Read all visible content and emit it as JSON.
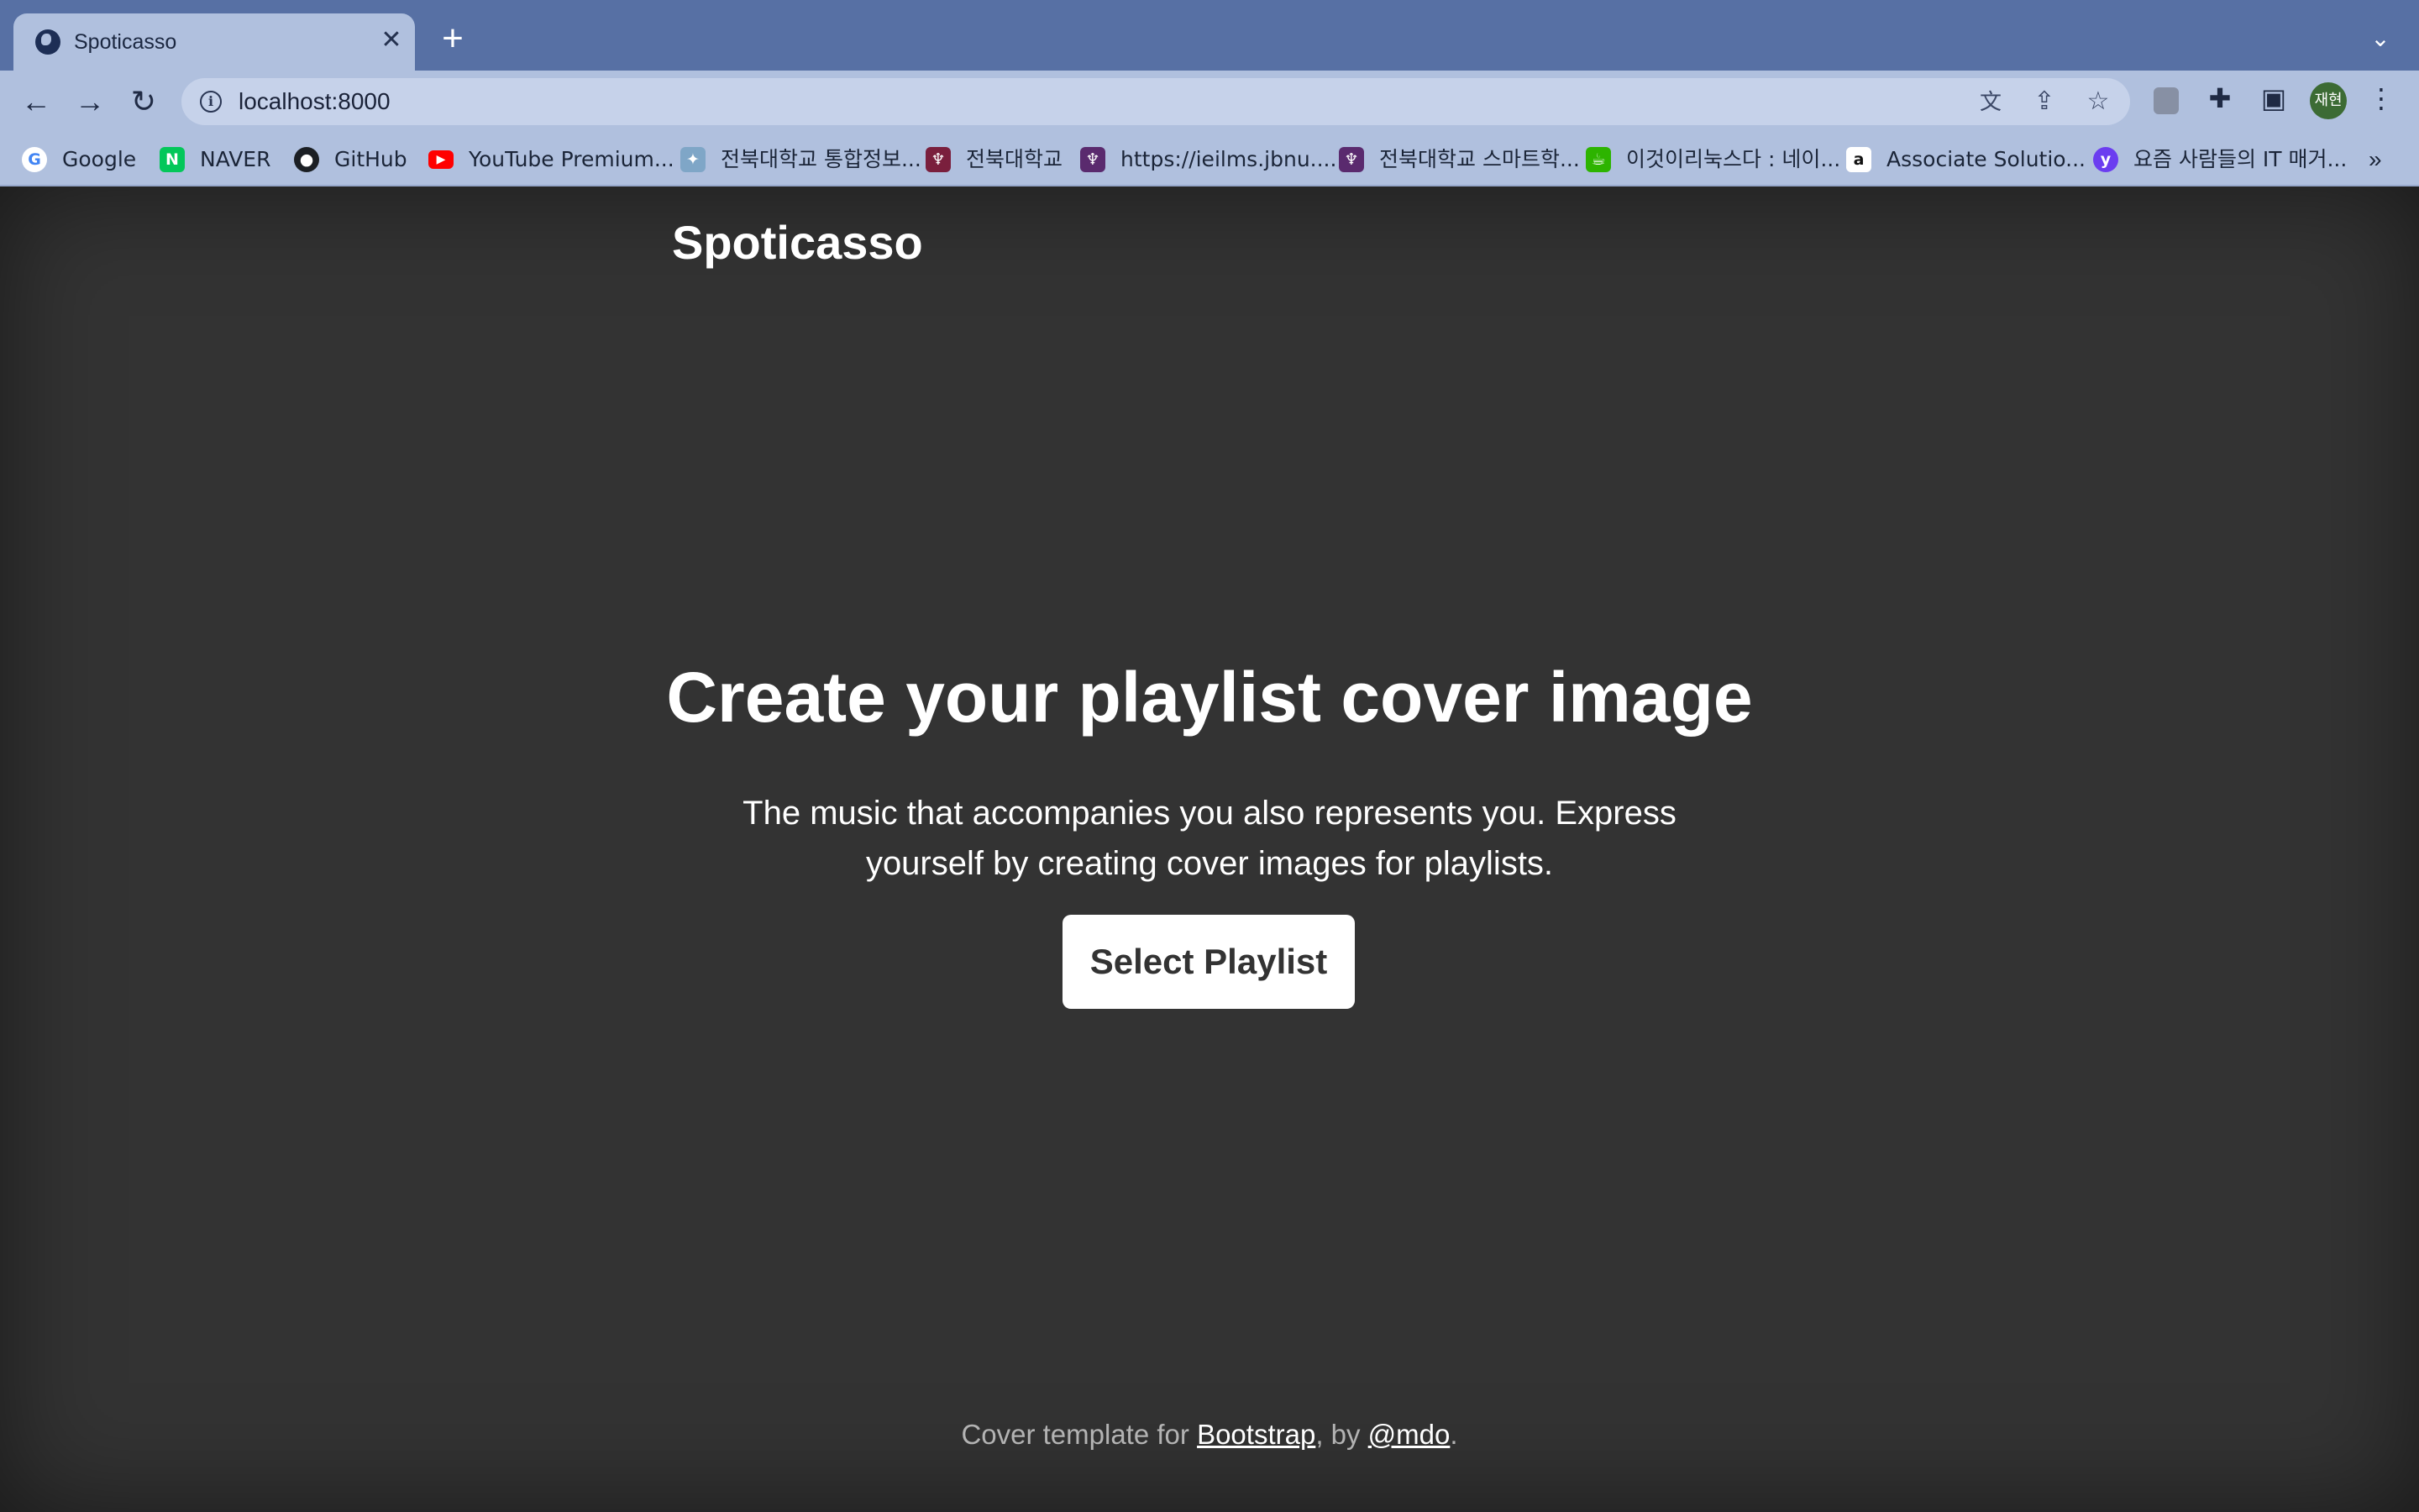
{
  "browser": {
    "tab": {
      "title": "Spoticasso",
      "close_icon": "close-icon",
      "favicon": "globe-icon"
    },
    "new_tab_icon": "plus-icon",
    "tab_search_icon": "chevron-down-icon",
    "nav": {
      "back_icon": "arrow-left-icon",
      "forward_icon": "arrow-right-icon",
      "reload_icon": "reload-icon"
    },
    "address": {
      "url": "localhost:8000",
      "info_icon": "info-icon",
      "translate_icon": "translate-icon",
      "share_icon": "share-icon",
      "bookmark_icon": "star-icon"
    },
    "extensions": [
      "lightbulb-icon",
      "puzzle-icon",
      "sidepanel-icon"
    ],
    "profile": {
      "avatar_text": "재현",
      "color": "#3c6b34"
    },
    "menu_icon": "more-vertical-icon",
    "bookmarks": [
      {
        "label": "Google",
        "icon": "google-icon"
      },
      {
        "label": "NAVER",
        "icon": "naver-icon"
      },
      {
        "label": "GitHub",
        "icon": "github-icon"
      },
      {
        "label": "YouTube Premium...",
        "icon": "youtube-icon"
      },
      {
        "label": "전북대학교 통합정보...",
        "icon": "jbnu-icon"
      },
      {
        "label": "전북대학교",
        "icon": "jbnu-crest-icon"
      },
      {
        "label": "https://ieilms.jbnu....",
        "icon": "jbnu-crest-icon"
      },
      {
        "label": "전북대학교 스마트학...",
        "icon": "jbnu-crest-icon"
      },
      {
        "label": "이것이리눅스다 : 네이...",
        "icon": "cafe-icon"
      },
      {
        "label": "Associate Solutio...",
        "icon": "amazon-icon"
      },
      {
        "label": "요즘 사람들의 IT 매거...",
        "icon": "magazine-icon"
      }
    ],
    "bookmarks_overflow": "»"
  },
  "page": {
    "brand": "Spoticasso",
    "heading": "Create your playlist cover image",
    "lead": "The music that accompanies you also represents you. Express yourself by creating cover images for playlists.",
    "cta_label": "Select Playlist",
    "footer": {
      "prefix": "Cover template for ",
      "link1": "Bootstrap",
      "middle": ", by ",
      "link2": "@mdo",
      "suffix": "."
    },
    "colors": {
      "background": "#333333",
      "text": "#ffffff",
      "muted": "#b3b3b3"
    }
  }
}
